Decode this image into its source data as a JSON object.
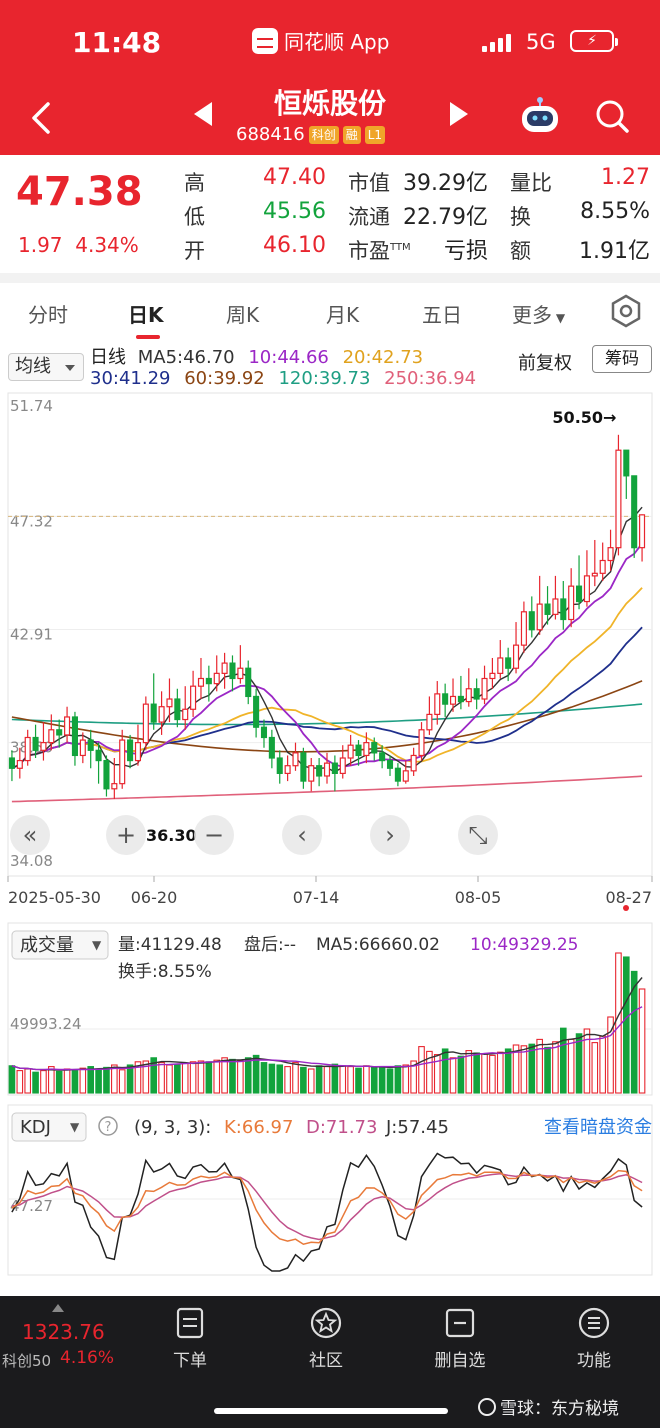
{
  "status": {
    "time": "11:48",
    "app": "同花顺 App",
    "network": "5G"
  },
  "stock": {
    "name": "恒烁股份",
    "code": "688416",
    "tags": [
      "科创",
      "融",
      "L1"
    ]
  },
  "quote": {
    "price": "47.38",
    "change": "1.97",
    "change_pct": "4.34%",
    "high_label": "高",
    "high": "47.40",
    "low_label": "低",
    "low": "45.56",
    "open_label": "开",
    "open": "46.10",
    "mktcap_label": "市值",
    "mktcap": "39.29亿",
    "float_label": "流通",
    "float": "22.79亿",
    "pe_label": "市盈",
    "pe_sup": "TTM",
    "pe": "亏损",
    "vr_label": "量比",
    "vr": "1.27",
    "turnover_label": "换",
    "turnover": "8.55%",
    "amount_label": "额",
    "amount": "1.91亿"
  },
  "tabs": [
    {
      "label": "分时"
    },
    {
      "label": "日K"
    },
    {
      "label": "周K"
    },
    {
      "label": "月K"
    },
    {
      "label": "五日"
    },
    {
      "label": "更多"
    }
  ],
  "ma_panel": {
    "selector": "均线",
    "title": "日线",
    "ma5": "MA5:46.70",
    "ma10": "10:44.66",
    "ma20": "20:42.73",
    "ma30": "30:41.29",
    "ma60": "60:39.92",
    "ma120": "120:39.73",
    "ma250": "250:36.94",
    "adjust": "前复权",
    "chip": "筹码"
  },
  "colors": {
    "up": "#e8252e",
    "down": "#12a33c",
    "ma5": "#333333",
    "ma10": "#9b27c6",
    "ma20": "#f0b429",
    "ma30": "#1f2f8c",
    "ma60": "#8b4513",
    "ma120": "#1e9e83",
    "ma250": "#e0607a"
  },
  "chart_data": {
    "type": "candlestick",
    "y_ticks": [
      "51.74",
      "47.32",
      "42.91",
      "38.50",
      "34.08"
    ],
    "ylim": [
      34.08,
      51.74
    ],
    "x_ticks": [
      "2025-05-30",
      "06-20",
      "07-14",
      "08-05",
      "08-27"
    ],
    "max_annotation": "50.50→",
    "min_annotation": "36.30",
    "last_price_line": 47.32,
    "candles": [
      [
        37.9,
        37.5,
        38.2,
        37.0
      ],
      [
        37.5,
        37.8,
        38.3,
        37.1
      ],
      [
        37.8,
        38.7,
        39.0,
        37.6
      ],
      [
        38.7,
        38.2,
        39.2,
        37.9
      ],
      [
        38.2,
        38.5,
        39.3,
        37.8
      ],
      [
        38.5,
        39.0,
        39.6,
        38.2
      ],
      [
        39.0,
        38.8,
        39.4,
        38.3
      ],
      [
        38.8,
        39.5,
        39.9,
        38.5
      ],
      [
        39.5,
        38.0,
        39.7,
        37.6
      ],
      [
        38.0,
        38.6,
        38.9,
        37.7
      ],
      [
        38.6,
        38.2,
        39.0,
        37.5
      ],
      [
        38.2,
        37.8,
        38.5,
        36.9
      ],
      [
        37.8,
        36.7,
        38.0,
        36.4
      ],
      [
        36.7,
        36.9,
        37.9,
        36.3
      ],
      [
        36.9,
        38.6,
        39.0,
        36.7
      ],
      [
        38.6,
        37.8,
        38.8,
        37.5
      ],
      [
        37.8,
        38.5,
        39.2,
        37.6
      ],
      [
        38.5,
        40.0,
        40.3,
        38.2
      ],
      [
        40.0,
        39.3,
        41.2,
        39.0
      ],
      [
        39.3,
        39.9,
        40.5,
        38.8
      ],
      [
        39.9,
        40.2,
        41.0,
        39.3
      ],
      [
        40.2,
        39.4,
        40.6,
        39.1
      ],
      [
        39.4,
        39.8,
        40.7,
        39.0
      ],
      [
        39.8,
        40.7,
        41.3,
        39.5
      ],
      [
        40.7,
        41.0,
        41.8,
        40.2
      ],
      [
        41.0,
        40.8,
        41.5,
        40.1
      ],
      [
        40.8,
        41.2,
        41.9,
        40.5
      ],
      [
        41.2,
        41.6,
        42.0,
        40.6
      ],
      [
        41.6,
        41.0,
        41.9,
        40.5
      ],
      [
        41.0,
        41.4,
        42.3,
        40.8
      ],
      [
        41.4,
        40.3,
        41.7,
        40.0
      ],
      [
        40.3,
        39.1,
        40.6,
        38.7
      ],
      [
        39.1,
        38.7,
        39.4,
        38.3
      ],
      [
        38.7,
        37.9,
        39.0,
        37.5
      ],
      [
        37.9,
        37.3,
        38.2,
        36.9
      ],
      [
        37.3,
        37.6,
        38.0,
        37.0
      ],
      [
        37.6,
        38.1,
        38.5,
        37.4
      ],
      [
        38.1,
        37.0,
        38.3,
        36.7
      ],
      [
        37.0,
        37.6,
        37.9,
        36.6
      ],
      [
        37.6,
        37.2,
        37.9,
        36.8
      ],
      [
        37.2,
        37.7,
        38.1,
        36.9
      ],
      [
        37.7,
        37.3,
        38.0,
        36.6
      ],
      [
        37.3,
        37.9,
        38.4,
        37.1
      ],
      [
        37.9,
        38.4,
        38.8,
        37.6
      ],
      [
        38.4,
        38.0,
        38.6,
        37.6
      ],
      [
        38.0,
        38.5,
        38.9,
        37.7
      ],
      [
        38.5,
        38.1,
        38.7,
        37.8
      ],
      [
        38.1,
        37.8,
        38.4,
        37.5
      ],
      [
        37.8,
        37.5,
        38.0,
        37.2
      ],
      [
        37.5,
        37.0,
        37.7,
        36.8
      ],
      [
        37.0,
        37.4,
        37.8,
        36.9
      ],
      [
        37.4,
        38.0,
        38.3,
        37.2
      ],
      [
        38.0,
        39.0,
        39.3,
        37.8
      ],
      [
        39.0,
        39.6,
        40.3,
        38.8
      ],
      [
        39.6,
        40.4,
        40.9,
        39.2
      ],
      [
        40.4,
        40.0,
        40.8,
        39.5
      ],
      [
        40.0,
        40.3,
        41.0,
        39.7
      ],
      [
        40.3,
        40.1,
        41.1,
        39.8
      ],
      [
        40.1,
        40.6,
        41.4,
        39.9
      ],
      [
        40.6,
        40.2,
        41.0,
        39.8
      ],
      [
        40.2,
        41.0,
        41.5,
        40.0
      ],
      [
        41.0,
        41.2,
        41.8,
        40.6
      ],
      [
        41.2,
        41.8,
        42.5,
        41.0
      ],
      [
        41.8,
        41.4,
        42.2,
        40.9
      ],
      [
        41.4,
        42.3,
        43.2,
        41.2
      ],
      [
        42.3,
        43.6,
        44.0,
        42.0
      ],
      [
        43.6,
        42.9,
        44.2,
        42.6
      ],
      [
        42.9,
        43.9,
        45.0,
        42.7
      ],
      [
        43.9,
        43.5,
        44.6,
        43.1
      ],
      [
        43.5,
        44.1,
        45.0,
        43.3
      ],
      [
        44.1,
        43.3,
        44.8,
        42.9
      ],
      [
        43.3,
        44.6,
        45.3,
        43.0
      ],
      [
        44.6,
        44.0,
        45.8,
        43.7
      ],
      [
        44.0,
        45.0,
        46.0,
        43.8
      ],
      [
        45.0,
        45.1,
        46.4,
        44.6
      ],
      [
        45.1,
        45.6,
        46.3,
        44.8
      ],
      [
        45.6,
        46.1,
        46.8,
        45.2
      ],
      [
        46.1,
        49.9,
        50.5,
        45.8
      ],
      [
        49.9,
        48.9,
        49.6,
        48.0
      ],
      [
        48.9,
        46.1,
        48.6,
        45.7
      ],
      [
        46.1,
        47.38,
        47.4,
        45.56
      ]
    ]
  },
  "volume": {
    "selector": "成交量",
    "vol": "量:41129.48",
    "after": "盘后:--",
    "ma5": "MA5:66660.02",
    "ma10": "10:49329.25",
    "turnover": "换手:8.55%",
    "tick": "49993.24",
    "values": [
      34,
      28,
      30,
      26,
      28,
      33,
      27,
      30,
      28,
      31,
      33,
      30,
      32,
      35,
      29,
      35,
      39,
      40,
      44,
      38,
      35,
      36,
      37,
      39,
      40,
      39,
      41,
      44,
      42,
      40,
      44,
      47,
      38,
      36,
      35,
      33,
      38,
      32,
      30,
      34,
      33,
      36,
      34,
      33,
      31,
      34,
      32,
      33,
      30,
      34,
      35,
      40,
      58,
      52,
      48,
      55,
      44,
      46,
      53,
      50,
      49,
      47,
      51,
      55,
      60,
      59,
      61,
      67,
      57,
      64,
      81,
      67,
      74,
      80,
      63,
      71,
      95,
      175,
      170,
      152,
      130
    ]
  },
  "kdj": {
    "selector": "KDJ",
    "params": "(9, 3, 3):",
    "k": "K:66.97",
    "d": "D:71.73",
    "j": "J:57.45",
    "tick": "47.27",
    "link": "查看暗盘资金"
  },
  "nav_buttons": {
    "zoom_in": "+",
    "zoom_out": "−"
  },
  "bottom_nav": {
    "index_value": "1323.76",
    "index_name": "科创50",
    "index_pct": "4.16%",
    "items": [
      {
        "label": "下单"
      },
      {
        "label": "社区"
      },
      {
        "label": "删自选"
      },
      {
        "label": "功能"
      }
    ],
    "watermark": "雪球：东方秘境"
  }
}
